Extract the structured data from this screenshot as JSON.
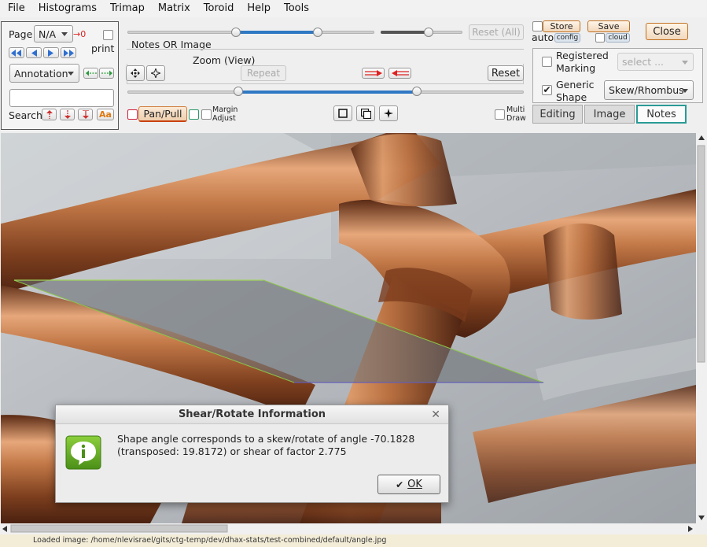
{
  "menu": [
    "File",
    "Histograms",
    "Trimap",
    "Matrix",
    "Toroid",
    "Help",
    "Tools"
  ],
  "left_panel": {
    "page_label": "Page",
    "page_value": "N/A",
    "page_jump": "→0",
    "print_label": "print",
    "annotation_value": "Annotation",
    "search_label": "Search",
    "search_value": "",
    "case_label": "Aa",
    "nav_icons": [
      "double-left-arrow-icon",
      "left-arrow-icon",
      "right-arrow-icon",
      "double-right-arrow-icon"
    ],
    "search_icons": [
      "search-prev-icon",
      "search-next-icon",
      "search-last-icon"
    ]
  },
  "controls": {
    "reset_all_label": "Reset (All)",
    "notes_or_image_label": "Notes OR Image",
    "zoom_label": "Zoom (View)",
    "repeat_label": "Repeat",
    "reset_label": "Reset",
    "pan_pull_label": "Pan/Pull",
    "margin_adjust_label": "Margin Adjust",
    "multi_draw_label": "Multi Draw",
    "sliders": {
      "top_range": [
        0.44,
        0.77
      ],
      "small": 0.59,
      "zoom_range": [
        0.28,
        0.73
      ]
    }
  },
  "right": {
    "auto_label": "auto",
    "config_label": "config",
    "store_label": "Store",
    "save_label": "Save",
    "cloud_label": "cloud",
    "close_label": "Close",
    "registered_marking_label": "Registered Marking",
    "registered_select_value": "select ...",
    "generic_shape_label": "Generic Shape",
    "generic_shape_checked": "✔",
    "shape_select_value": "Skew/Rhombus"
  },
  "tabs": [
    "Editing",
    "Image",
    "Notes"
  ],
  "active_tab": "Notes",
  "dialog": {
    "title": "Shear/Rotate Information",
    "close_glyph": "✕",
    "message": "Shape angle corresponds to a skew/rotate of angle -70.1828 (transposed: 19.8172) or shear of factor 2.775",
    "ok_label": "OK",
    "ok_glyph": "✔"
  },
  "status": "Loaded image: /home/nlevisrael/gits/ctg-temp/dev/dhax-stats/test-combined/default/angle.jpg",
  "colors": {
    "accent_blue": "#2f78c4",
    "tab_active_border": "#2a9b97",
    "status_bg": "#f3edd8",
    "copper": "#c07a4a",
    "overlay": "#6b6f74"
  }
}
